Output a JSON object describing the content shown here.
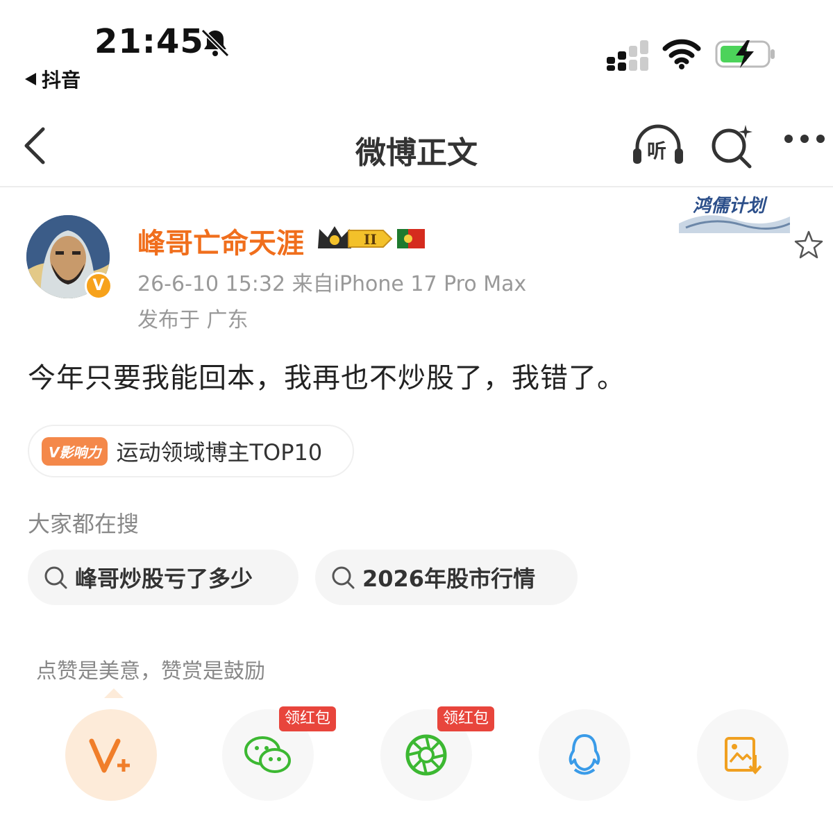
{
  "status_bar": {
    "time": "21:45",
    "back_app": "抖音"
  },
  "nav": {
    "title": "微博正文",
    "listen_label": "听"
  },
  "post": {
    "author": "峰哥亡命天涯",
    "member_level": "II",
    "timestamp_source": "26-6-10 15:32  来自iPhone 17 Pro Max",
    "location": "发布于 广东",
    "plan_badge": "鸿儒计划",
    "text": "今年只要我能回本，我再也不炒股了，我错了。",
    "influence_tag": "V影响力",
    "influence_text": "运动领域博主TOP10"
  },
  "search": {
    "heading": "大家都在搜",
    "chips": [
      "峰哥炒股亏了多少",
      "2026年股市行情"
    ]
  },
  "share": {
    "hint": "点赞是美意，赞赏是鼓励",
    "red_packet_label": "领红包",
    "buttons": [
      "reward-icon",
      "wechat-icon",
      "moments-icon",
      "qq-icon",
      "save-image-icon"
    ]
  },
  "colors": {
    "accent": "#f06e1c",
    "red_tag": "#e8453c",
    "wechat_green": "#3cb832",
    "qq_blue": "#3a9be8"
  }
}
